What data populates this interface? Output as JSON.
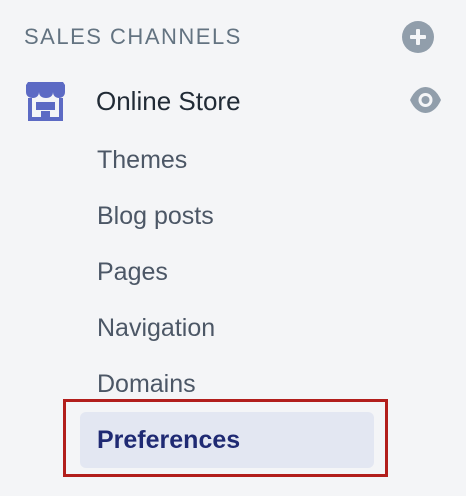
{
  "sidebar": {
    "section_title": "SALES CHANNELS",
    "channel_label": "Online Store",
    "items": [
      {
        "label": "Themes"
      },
      {
        "label": "Blog posts"
      },
      {
        "label": "Pages"
      },
      {
        "label": "Navigation"
      },
      {
        "label": "Domains"
      }
    ],
    "active_item": {
      "label": "Preferences"
    }
  },
  "icons": {
    "add": "plus-circle-icon",
    "store": "storefront-icon",
    "view": "eye-icon"
  },
  "colors": {
    "background": "#f4f5f7",
    "active_background": "#e3e7f2",
    "active_text": "#1f2a73",
    "accent_icon": "#5c6ac4",
    "highlight": "#b21e1c",
    "muted_icon": "#919eab"
  }
}
